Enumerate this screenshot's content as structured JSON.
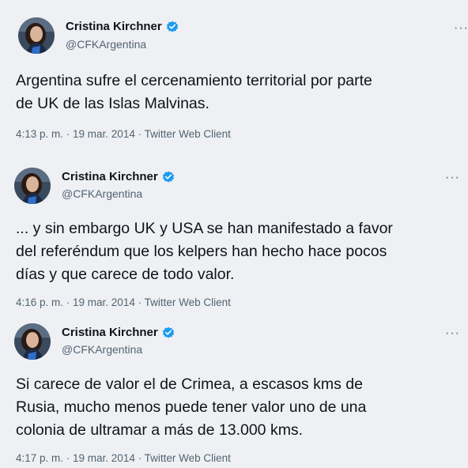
{
  "tweets": [
    {
      "author": "Cristina Kirchner",
      "handle": "@CFKArgentina",
      "lines": [
        "Argentina sufre el cercenamiento territorial por parte",
        "de UK de las Islas Malvinas."
      ],
      "meta": "4:13 p. m. · 19 mar. 2014 · Twitter Web Client",
      "more": "···"
    },
    {
      "author": "Cristina Kirchner",
      "handle": "@CFKArgentina",
      "lines": [
        "... y sin embargo UK y USA se han manifestado a favor",
        "del referéndum que los kelpers han hecho hace pocos",
        "días y que carece de todo valor."
      ],
      "meta": "4:16 p. m. · 19 mar. 2014 · Twitter Web Client",
      "more": "···"
    },
    {
      "author": "Cristina Kirchner",
      "handle": "@CFKArgentina",
      "lines": [
        "Si carece de valor el de Crimea, a escasos kms de",
        "Rusia, mucho menos puede tener valor uno de una",
        "colonia de ultramar a más de 13.000 kms."
      ],
      "meta": "4:17 p. m. · 19 mar. 2014 · Twitter Web Client",
      "more": "···"
    }
  ],
  "colors": {
    "background": "#eef0f4",
    "text": "#0f1419",
    "secondary": "#536471",
    "verified": "#1d9bf0"
  },
  "icons": {
    "verified": "verified-badge-icon",
    "more": "more-options-icon"
  }
}
